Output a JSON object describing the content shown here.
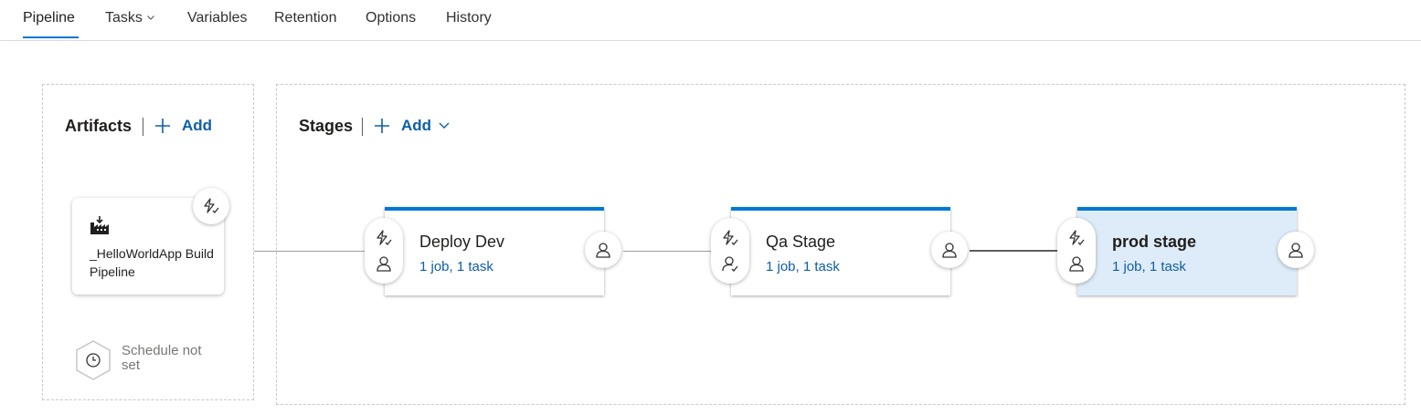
{
  "tabs": [
    {
      "label": "Pipeline",
      "active": true
    },
    {
      "label": "Tasks",
      "has_dropdown": true
    },
    {
      "label": "Variables"
    },
    {
      "label": "Retention"
    },
    {
      "label": "Options"
    },
    {
      "label": "History"
    }
  ],
  "artifacts": {
    "title": "Artifacts",
    "add_label": "Add",
    "items": [
      {
        "name": "_HelloWorldApp Build Pipeline",
        "icon": "build-pipeline-icon",
        "trigger_icon": "continuous-deployment-trigger-icon"
      }
    ],
    "schedule": {
      "text": "Schedule not set",
      "icon": "clock-icon"
    }
  },
  "stages": {
    "title": "Stages",
    "add_label": "Add",
    "items": [
      {
        "name": "Deploy Dev",
        "summary": "1 job, 1 task",
        "selected": false,
        "pre_icons": [
          "lightning-trigger-icon",
          "pre-deployment-approver-icon"
        ],
        "post_icon": "post-deployment-approver-icon"
      },
      {
        "name": "Qa Stage",
        "summary": "1 job, 1 task",
        "selected": false,
        "pre_icons": [
          "lightning-trigger-icon",
          "pre-deployment-approver-check-icon"
        ],
        "post_icon": "post-deployment-approver-icon"
      },
      {
        "name": "prod stage",
        "summary": "1 job, 1 task",
        "selected": true,
        "pre_icons": [
          "lightning-trigger-icon",
          "pre-deployment-approver-icon"
        ],
        "post_icon": "post-deployment-approver-icon"
      }
    ]
  },
  "colors": {
    "accent": "#0078d4",
    "link": "#0f5ea8",
    "selected_stage_bg": "#deecf9"
  }
}
